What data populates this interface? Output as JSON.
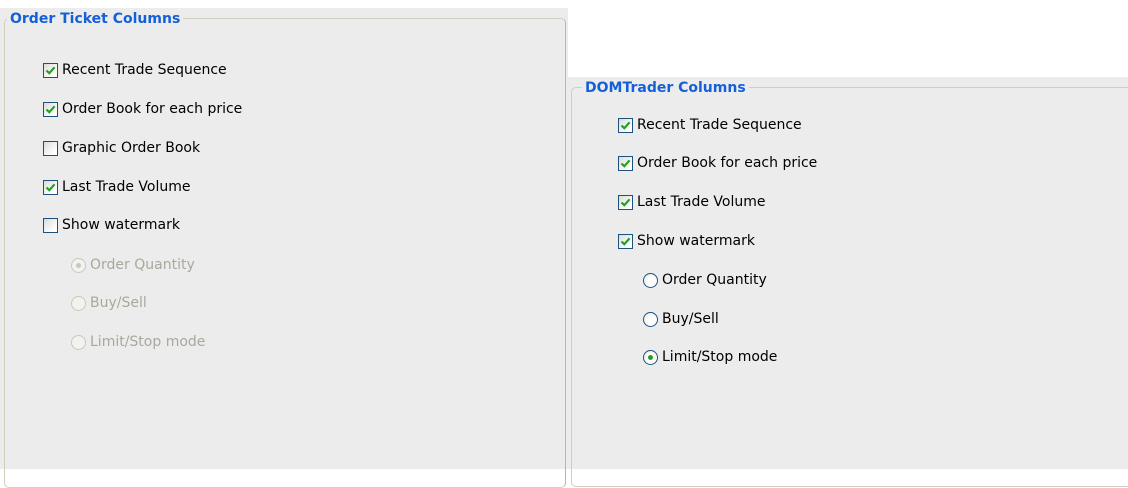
{
  "order_ticket": {
    "title": "Order Ticket Columns",
    "checkboxes": [
      {
        "label": "Recent Trade Sequence",
        "checked": true
      },
      {
        "label": "Order Book for each price",
        "checked": true
      },
      {
        "label": "Graphic Order Book",
        "checked": false
      },
      {
        "label": "Last Trade Volume",
        "checked": true
      },
      {
        "label": "Show watermark",
        "checked": false
      }
    ],
    "watermark_options": [
      {
        "label": "Order Quantity",
        "selected": true,
        "disabled": true
      },
      {
        "label": "Buy/Sell",
        "selected": false,
        "disabled": true
      },
      {
        "label": "Limit/Stop mode",
        "selected": false,
        "disabled": true
      }
    ]
  },
  "domtrader": {
    "title": "DOMTrader Columns",
    "checkboxes": [
      {
        "label": "Recent Trade Sequence",
        "checked": true
      },
      {
        "label": "Order Book for each price",
        "checked": true
      },
      {
        "label": "Last Trade Volume",
        "checked": true
      },
      {
        "label": "Show watermark",
        "checked": true
      }
    ],
    "watermark_options": [
      {
        "label": "Order Quantity",
        "selected": false,
        "disabled": false
      },
      {
        "label": "Buy/Sell",
        "selected": false,
        "disabled": false
      },
      {
        "label": "Limit/Stop mode",
        "selected": true,
        "disabled": false
      }
    ]
  },
  "colors": {
    "legend": "#1560d8",
    "check": "#21a121",
    "panel": "#ececec",
    "border": "#d0d0bf"
  }
}
